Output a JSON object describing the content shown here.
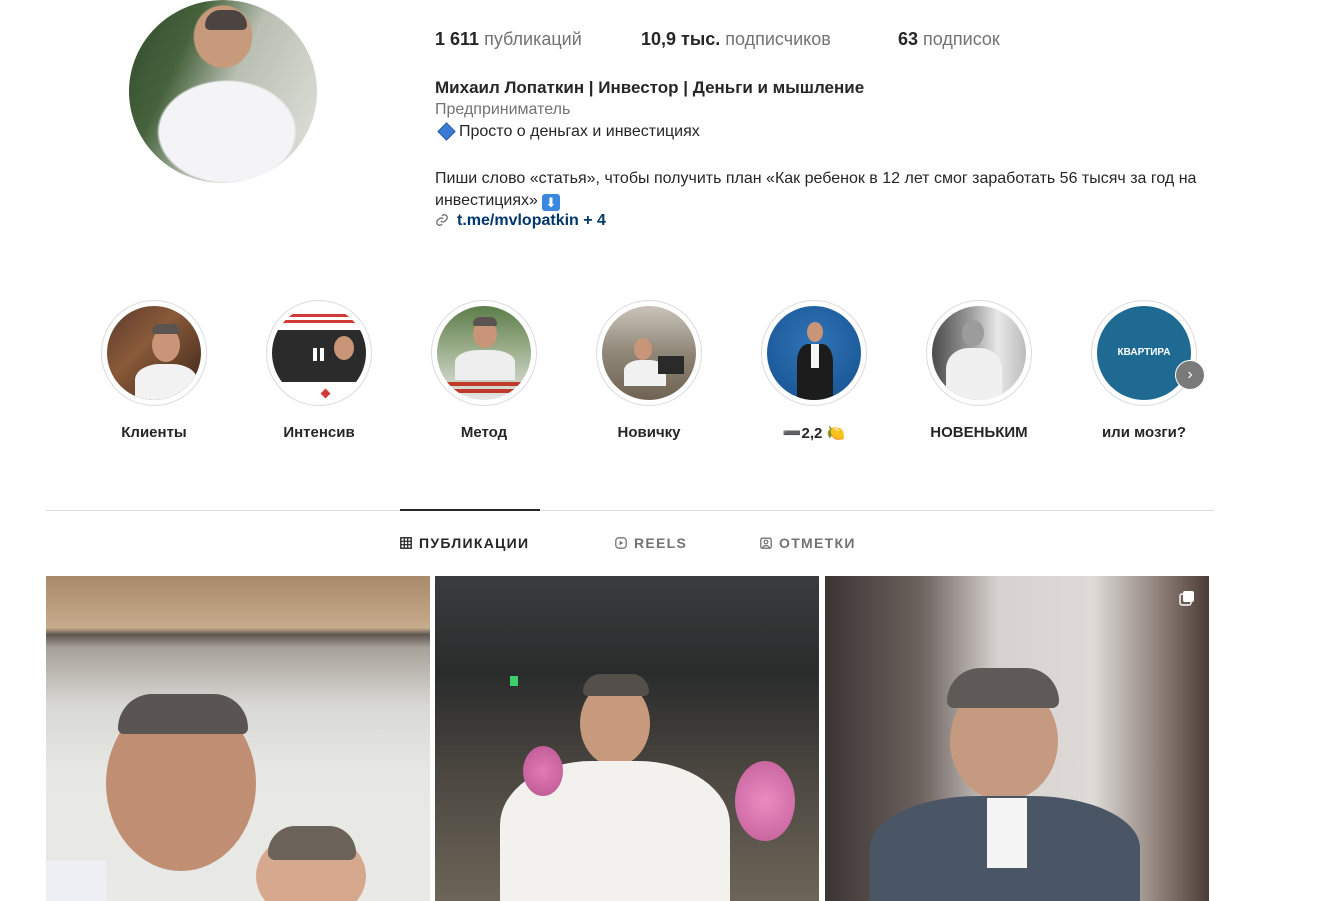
{
  "profile": {
    "stats": [
      {
        "count": "1 611",
        "label": "публикаций"
      },
      {
        "count": "10,9 тыс.",
        "label": "подписчиков"
      },
      {
        "count": "63",
        "label": "подписок"
      }
    ],
    "name": "Михаил Лопаткин | Инвестор | Деньги и мышление",
    "category": "Предприниматель",
    "bio_line1": "Просто о деньгах и инвестициях",
    "bio_line2": "Пиши слово «статья», чтобы получить план «Как ребенок в 12 лет смог заработать 56 тысяч за год на инвестициях»",
    "bio_arrow": "⬇",
    "link_text": "t.me/mvlopatkin + 4"
  },
  "highlights": [
    {
      "label": "Клиенты"
    },
    {
      "label": "Интенсив"
    },
    {
      "label": "Метод"
    },
    {
      "label": "Новичку"
    },
    {
      "label": "➖2,2 🍋"
    },
    {
      "label": "НОВЕНЬКИМ"
    },
    {
      "label": "или мозги?",
      "cover_text": "КВАРТИРА"
    }
  ],
  "tabs": [
    {
      "label": "ПУБЛИКАЦИИ",
      "active": true
    },
    {
      "label": "REELS",
      "active": false
    },
    {
      "label": "ОТМЕТКИ",
      "active": false
    }
  ],
  "colors": {
    "text": "#262626",
    "secondary": "#737373",
    "link": "#00376b",
    "border": "#dbdbdb"
  },
  "icons": [
    "link-icon",
    "grid-icon",
    "reels-icon",
    "tagged-icon",
    "chevron-right-icon",
    "carousel-icon"
  ]
}
